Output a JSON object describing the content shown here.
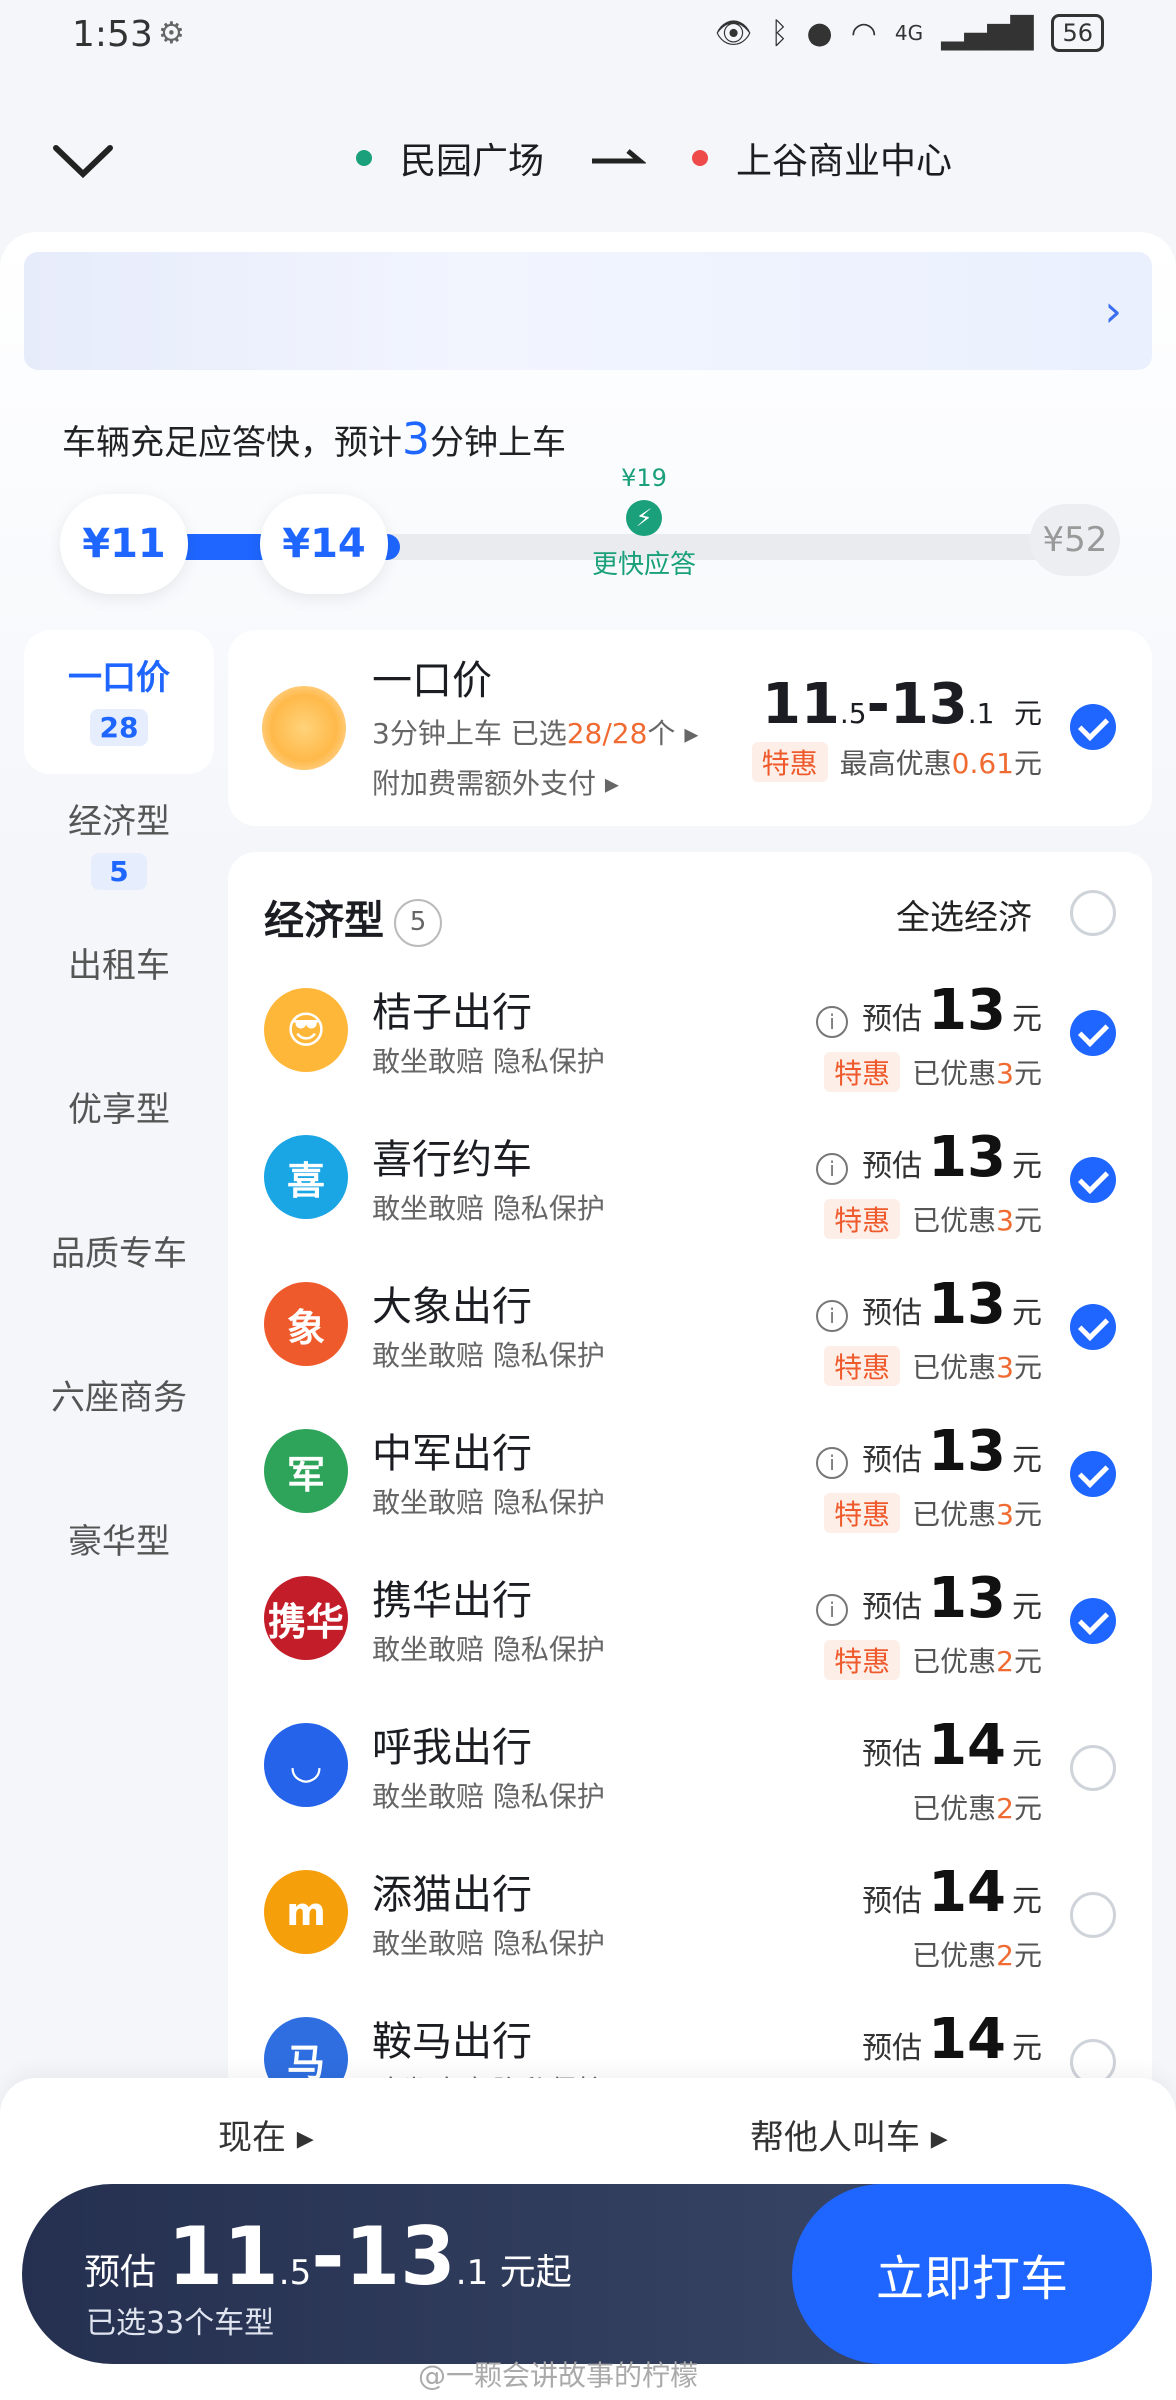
{
  "status": {
    "time": "1:53",
    "battery": "56",
    "signal": "4G"
  },
  "route": {
    "from": "民园广场",
    "to": "上谷商业中心",
    "from_color": "#1aa07a",
    "to_color": "#ef4a4a"
  },
  "eta": {
    "prefix": "车辆充足应答快，预计",
    "minutes": "3",
    "suffix": "分钟上车"
  },
  "price_slider": {
    "low": "¥11",
    "selected": "¥14",
    "fast_price": "¥19",
    "fast_label": "更快应答",
    "max": "¥52"
  },
  "sidebar": [
    {
      "label": "一口价",
      "count": "28",
      "selected": true
    },
    {
      "label": "经济型",
      "count": "5"
    },
    {
      "label": "出租车"
    },
    {
      "label": "优享型"
    },
    {
      "label": "品质专车"
    },
    {
      "label": "六座商务"
    },
    {
      "label": "豪华型"
    }
  ],
  "fixed": {
    "title": "一口价",
    "sub1_prefix": "3分钟上车  已选",
    "sub1_count": "28/28",
    "sub1_suffix": "个 ▸",
    "sub2": "附加费需额外支付 ▸",
    "price_a": "11",
    "price_a_dec": ".5",
    "price_b": "-13",
    "price_b_dec": ".1",
    "unit": "元",
    "badge": "特惠",
    "disc_prefix": "最高优惠",
    "disc_value": "0.61",
    "disc_unit": "元"
  },
  "economy": {
    "title": "经济型",
    "count": "5",
    "select_all": "全选经济",
    "rows": [
      {
        "name": "桔子出行",
        "sub": "敢坐敢赔  隐私保护",
        "est": "预估",
        "price": "13",
        "unit": "元",
        "badge": "特惠",
        "saved_prefix": "已优惠",
        "saved": "3",
        "saved_unit": "元",
        "logo_color": "#ffb73a",
        "logo_text": "😎",
        "checked": true
      },
      {
        "name": "喜行约车",
        "sub": "敢坐敢赔  隐私保护",
        "est": "预估",
        "price": "13",
        "unit": "元",
        "badge": "特惠",
        "saved_prefix": "已优惠",
        "saved": "3",
        "saved_unit": "元",
        "logo_color": "#1aa5e4",
        "logo_text": "喜",
        "checked": true
      },
      {
        "name": "大象出行",
        "sub": "敢坐敢赔  隐私保护",
        "est": "预估",
        "price": "13",
        "unit": "元",
        "badge": "特惠",
        "saved_prefix": "已优惠",
        "saved": "3",
        "saved_unit": "元",
        "logo_color": "#ef5a2c",
        "logo_text": "象",
        "checked": true
      },
      {
        "name": "中军出行",
        "sub": "敢坐敢赔  隐私保护",
        "est": "预估",
        "price": "13",
        "unit": "元",
        "badge": "特惠",
        "saved_prefix": "已优惠",
        "saved": "3",
        "saved_unit": "元",
        "logo_color": "#2ea35a",
        "logo_text": "军",
        "checked": true
      },
      {
        "name": "携华出行",
        "sub": "敢坐敢赔  隐私保护",
        "est": "预估",
        "price": "13",
        "unit": "元",
        "badge": "特惠",
        "saved_prefix": "已优惠",
        "saved": "2",
        "saved_unit": "元",
        "logo_color": "#c41d2a",
        "logo_text": "携华",
        "checked": true
      },
      {
        "name": "呼我出行",
        "sub": "敢坐敢赔  隐私保护",
        "est": "预估",
        "price": "14",
        "unit": "元",
        "badge": "",
        "saved_prefix": "已优惠",
        "saved": "2",
        "saved_unit": "元",
        "logo_color": "#2563eb",
        "logo_text": "◡",
        "checked": false
      },
      {
        "name": "添猫出行",
        "sub": "敢坐敢赔  隐私保护",
        "est": "预估",
        "price": "14",
        "unit": "元",
        "badge": "",
        "saved_prefix": "已优惠",
        "saved": "2",
        "saved_unit": "元",
        "logo_color": "#f59f0b",
        "logo_text": "m",
        "checked": false
      },
      {
        "name": "鞍马出行",
        "sub": "敢坐敢赔  隐私保护",
        "est": "预估",
        "price": "14",
        "unit": "元",
        "badge": "",
        "saved_prefix": "",
        "saved": "",
        "saved_unit": "",
        "logo_color": "#2f6ee0",
        "logo_text": "马",
        "checked": false
      }
    ]
  },
  "bottom": {
    "now": "现在 ▸",
    "for_other": "帮他人叫车 ▸",
    "est_label": "预估",
    "price_a": "11",
    "price_a_dec": ".5",
    "price_b": "-13",
    "price_b_dec": ".1",
    "suffix": "元起",
    "selected": "已选33个车型",
    "cta": "立即打车"
  },
  "watermark": "@一颗会讲故事的柠檬"
}
